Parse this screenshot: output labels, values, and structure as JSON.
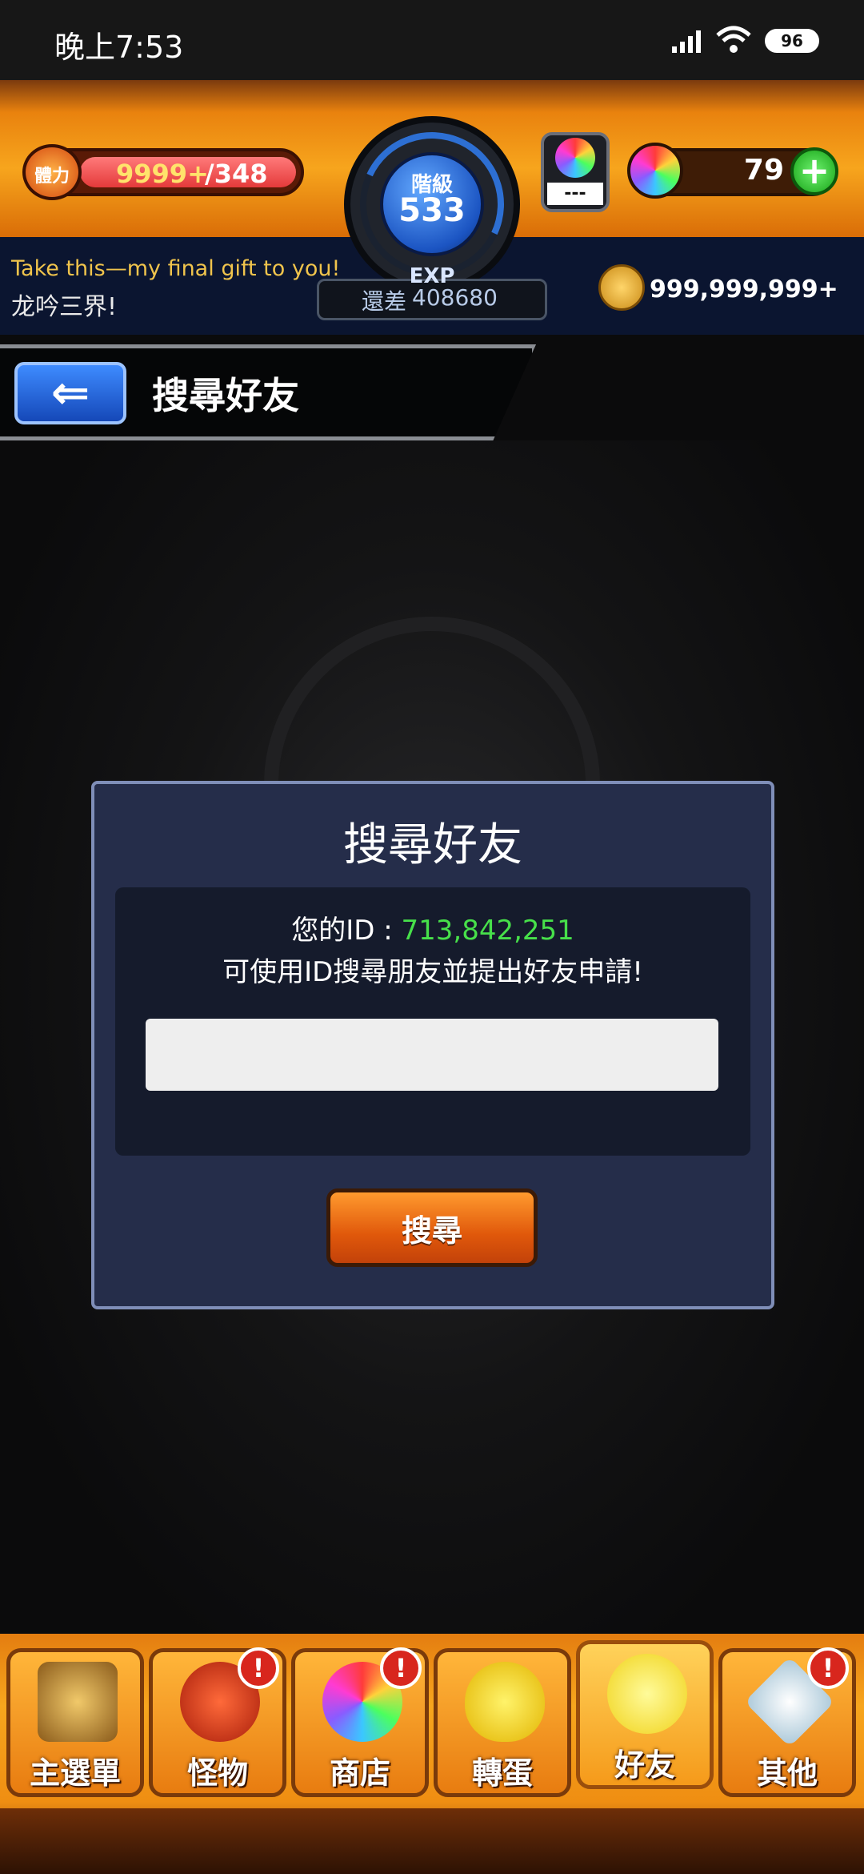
{
  "status_bar": {
    "time": "晚上7:53",
    "battery": "96"
  },
  "hud": {
    "stamina_label": "體力",
    "stamina_current": "9999+",
    "stamina_max": "/348",
    "rank_label": "階級",
    "rank_value": "533",
    "exp_label": "EXP",
    "exp_diff_label": "還差",
    "exp_diff_value": "408680",
    "ticket_text": "---",
    "gem_count": "79",
    "gem_add": "+",
    "message_line1": "Take this—my final gift to you!",
    "message_line2": "龙吟三界!",
    "coin_value": "999,999,999+"
  },
  "header": {
    "back_arrow": "⇐",
    "title": "搜尋好友"
  },
  "dialog": {
    "title": "搜尋好友",
    "id_label": "您的ID : ",
    "id_value": "713,842,251",
    "instruction": "可使用ID搜尋朋友並提出好友申請!",
    "input_value": "",
    "search_button": "搜尋"
  },
  "bottom_nav": {
    "items": [
      {
        "label": "主選單",
        "badge": ""
      },
      {
        "label": "怪物",
        "badge": "!"
      },
      {
        "label": "商店",
        "badge": "!"
      },
      {
        "label": "轉蛋",
        "badge": ""
      },
      {
        "label": "好友",
        "badge": ""
      },
      {
        "label": "其他",
        "badge": "!"
      }
    ]
  },
  "colors": {
    "accent_orange": "#f7a51d",
    "id_green": "#47e04a",
    "dialog_bg": "#252d4a",
    "badge_red": "#d8261d"
  }
}
